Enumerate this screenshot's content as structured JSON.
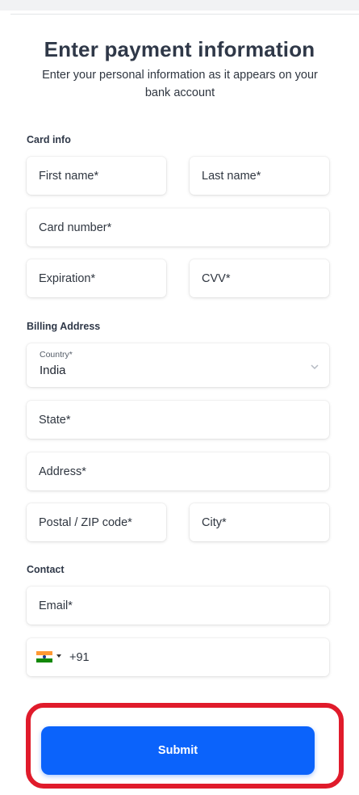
{
  "header": {
    "title": "Enter payment information",
    "subtitle": "Enter your personal information as it appears on your bank account"
  },
  "card_info": {
    "heading": "Card info",
    "first_name_placeholder": "First name*",
    "last_name_placeholder": "Last name*",
    "card_number_placeholder": "Card number*",
    "expiration_placeholder": "Expiration*",
    "cvv_placeholder": "CVV*"
  },
  "billing": {
    "heading": "Billing Address",
    "country_label": "Country*",
    "country_value": "India",
    "state_placeholder": "State*",
    "address_placeholder": "Address*",
    "postal_placeholder": "Postal / ZIP code*",
    "city_placeholder": "City*"
  },
  "contact": {
    "heading": "Contact",
    "email_placeholder": "Email*",
    "phone_dial_code": "+91",
    "phone_flag_icon": "india-flag-icon"
  },
  "actions": {
    "submit_label": "Submit"
  },
  "colors": {
    "primary": "#0b63fb",
    "highlight": "#e01b2b",
    "flag_saffron": "#ff9933",
    "flag_green": "#138808"
  }
}
